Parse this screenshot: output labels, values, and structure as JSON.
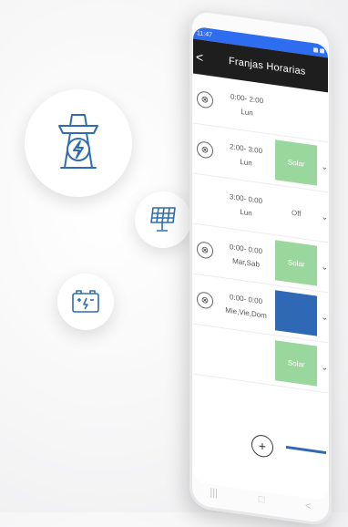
{
  "app": {
    "status_time": "11:47",
    "title": "Franjas Horarias",
    "back_label": "<"
  },
  "rows": [
    {
      "time": "0:00- 2:00",
      "days": "Lun",
      "mode": "Solar"
    },
    {
      "time": "2:00- 3:00",
      "days": "Lun",
      "mode": "Solar"
    },
    {
      "time": "3:00- 0:00",
      "days": "Lun",
      "mode": "Off"
    },
    {
      "time": "0:00- 0:00",
      "days": "Mar,Sab",
      "mode": "Solar"
    },
    {
      "time": "0:00- 0:00",
      "days": "Mie,Vie,Dom",
      "mode": "Red"
    },
    {
      "time": "",
      "days": "",
      "mode": "Solar"
    }
  ],
  "icons": {
    "row_remove": "⊗",
    "add": "+",
    "chevron": "⌄",
    "nav_recent": "|||",
    "nav_home": "□",
    "nav_back": "<"
  },
  "colors": {
    "solar": "#9ad79c",
    "red": "#2f68b4",
    "status_bar": "#2f6df0",
    "appbar": "#1e1e1e",
    "icon_stroke": "#2f6db0"
  }
}
